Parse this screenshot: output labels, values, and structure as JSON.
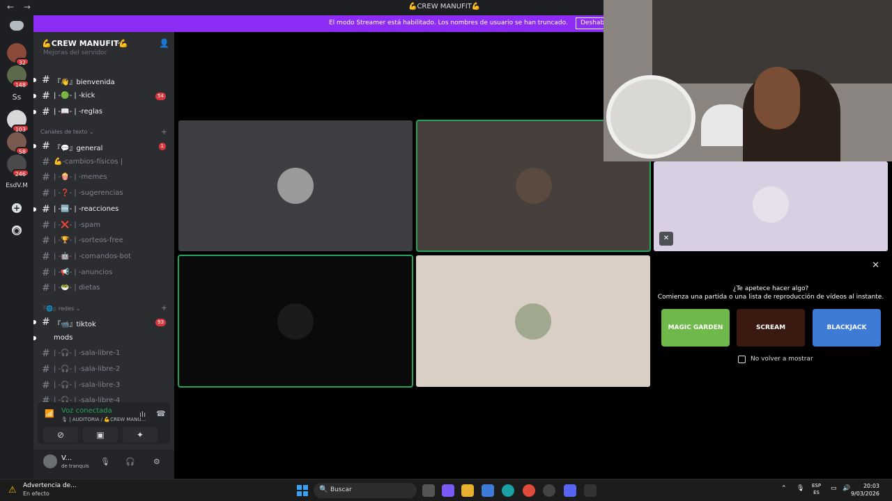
{
  "window": {
    "title": "💪CREW MANUFIT💪",
    "back": "←",
    "forward": "→"
  },
  "banner": {
    "message": "El modo Streamer está habilitado. Los nombres de usuario se han truncado.",
    "button": "Deshabilitar"
  },
  "servers": [
    {
      "badge": "32"
    },
    {
      "badge": "148"
    },
    {
      "label": "Ss"
    },
    {
      "badge": "103"
    },
    {
      "badge": "58"
    },
    {
      "badge": "246"
    },
    {
      "label": "EsdV.M"
    }
  ],
  "server": {
    "name": "💪CREW MANUFIT💪",
    "cut_row": "Mejoras del servidor"
  },
  "channels_top": [
    {
      "label": "『👋』bienvenida",
      "bold": true,
      "badge": ""
    },
    {
      "label": "| -🟢- | -kick",
      "bold": true,
      "badge": "54"
    },
    {
      "label": "| -📖- | -reglas",
      "bold": true,
      "badge": ""
    }
  ],
  "category_text": "Canales de texto",
  "channels_text": [
    {
      "label": "『💬』general",
      "bold": true,
      "badge": "1"
    },
    {
      "label": "💪-cambios-físicos |",
      "bold": false,
      "badge": ""
    },
    {
      "label": "| -🍿- | -memes",
      "bold": false,
      "badge": ""
    },
    {
      "label": "| -❓- | -sugerencias",
      "bold": false,
      "badge": ""
    },
    {
      "label": "| -🆒- | -reacciones",
      "bold": true,
      "badge": ""
    },
    {
      "label": "| -❌- | -spam",
      "bold": false,
      "badge": ""
    },
    {
      "label": "| -🏆- | -sorteos-free",
      "bold": false,
      "badge": ""
    },
    {
      "label": "| -🤖- | -comandos-bot",
      "bold": false,
      "badge": ""
    },
    {
      "label": "| -📢- | -anuncios",
      "bold": false,
      "badge": ""
    },
    {
      "label": "| -🥗- | dietas",
      "bold": false,
      "badge": ""
    }
  ],
  "category_redes": "『🌐』redes",
  "channels_redes": [
    {
      "label": "『📹』tiktok",
      "bold": true,
      "badge": "93"
    },
    {
      "label": "mods",
      "bold": true,
      "badge": ""
    },
    {
      "label": "| -🎧- | -sala-libre-1",
      "bold": false,
      "badge": ""
    },
    {
      "label": "| -🎧- | -sala-libre-2",
      "bold": false,
      "badge": ""
    },
    {
      "label": "| -🎧- | -sala-libre-3",
      "bold": false,
      "badge": ""
    },
    {
      "label": "| -🎧- | -sala-libre-4",
      "bold": false,
      "badge": ""
    }
  ],
  "voice": {
    "status": "Voz conectada",
    "location": "🎙 | AUDITORIA / 💪CREW MANU..."
  },
  "user": {
    "name": "V...",
    "status": "de tranquis"
  },
  "activity": {
    "question": "¿Te apetece hacer algo?",
    "subtitle": "Comienza una partida o una lista de reproducción de vídeos al instante.",
    "games": [
      "MAGIC GARDEN",
      "SCREAM",
      "BLACKJACK"
    ],
    "dont_show": "No volver a mostrar"
  },
  "taskbar": {
    "warning_title": "Advertencia de...",
    "warning_sub": "En efecto",
    "search": "Buscar",
    "lang_top": "ESP",
    "lang_bottom": "ES",
    "time": "20:03",
    "date": "9/03/2026"
  },
  "colors": {
    "accent": "#8c2cf5",
    "speaking": "#23a55a",
    "badge": "#da373c"
  }
}
